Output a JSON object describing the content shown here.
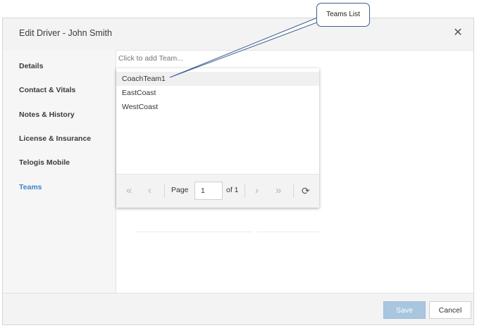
{
  "dialog": {
    "title": "Edit Driver - John Smith",
    "close_glyph": "✕"
  },
  "sidebar": {
    "items": [
      {
        "label": "Details",
        "active": false
      },
      {
        "label": "Contact & Vitals",
        "active": false
      },
      {
        "label": "Notes & History",
        "active": false
      },
      {
        "label": "License & Insurance",
        "active": false
      },
      {
        "label": "Telogis Mobile",
        "active": false
      },
      {
        "label": "Teams",
        "active": true
      }
    ],
    "active_color": "#3a86c8"
  },
  "teams": {
    "placeholder": "Click to add Team...",
    "options": [
      "CoachTeam1",
      "EastCoast",
      "WestCoast"
    ],
    "highlighted_option": "CoachTeam1"
  },
  "pager": {
    "page_label": "Page",
    "page_value": "1",
    "of_label": "of 1",
    "icons": {
      "first": "«",
      "prev": "‹",
      "next": "›",
      "last": "»",
      "refresh": "⟳"
    }
  },
  "footer": {
    "save_label": "Save",
    "cancel_label": "Cancel"
  },
  "callout": {
    "text": "Teams List"
  }
}
